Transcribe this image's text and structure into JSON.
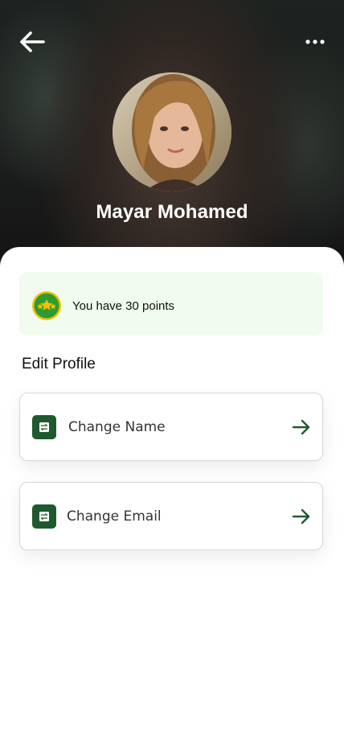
{
  "header": {
    "back_icon": "arrow-left-icon",
    "more_icon": "more-horizontal-icon",
    "user_name": "Mayar Mohamed"
  },
  "points": {
    "text": "You have 30 points",
    "icon": "stars-badge-icon"
  },
  "edit_profile": {
    "title": "Edit Profile",
    "options": [
      {
        "label": "Change Name",
        "icon": "swap-icon",
        "arrow_icon": "arrow-right-icon"
      },
      {
        "label": "Change Email",
        "icon": "swap-icon",
        "arrow_icon": "arrow-right-icon"
      }
    ]
  },
  "colors": {
    "accent": "#1f5a2e",
    "points_bg": "#f1fbef",
    "badge_fill": "#2f9b2f",
    "badge_ring": "#f2c200"
  }
}
